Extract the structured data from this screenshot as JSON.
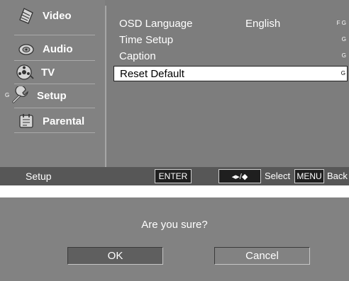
{
  "sidebar": {
    "items": [
      {
        "label": "Video",
        "icon": "video-icon"
      },
      {
        "label": "Audio",
        "icon": "audio-icon"
      },
      {
        "label": "TV",
        "icon": "tv-icon"
      },
      {
        "label": "Setup",
        "icon": "setup-icon",
        "marker": "G"
      },
      {
        "label": "Parental",
        "icon": "parental-icon"
      }
    ]
  },
  "menu": {
    "rows": [
      {
        "label": "OSD Language",
        "value": "English",
        "mark": "F G"
      },
      {
        "label": "Time Setup",
        "value": "",
        "mark": "G"
      },
      {
        "label": "Caption",
        "value": "",
        "mark": "G"
      },
      {
        "label": "Reset Default",
        "value": "",
        "mark": "G",
        "selected": true
      }
    ]
  },
  "statusbar": {
    "section": "Setup",
    "enter_key": "ENTER",
    "nav_key": "◂▸/◆",
    "select_label": "Select",
    "menu_key": "MENU",
    "back_label": "Back"
  },
  "dialog": {
    "question": "Are you sure?",
    "ok_label": "OK",
    "cancel_label": "Cancel"
  },
  "colors": {
    "panel": "#828282",
    "statusbar": "#575757",
    "highlight": "#ffffff"
  }
}
